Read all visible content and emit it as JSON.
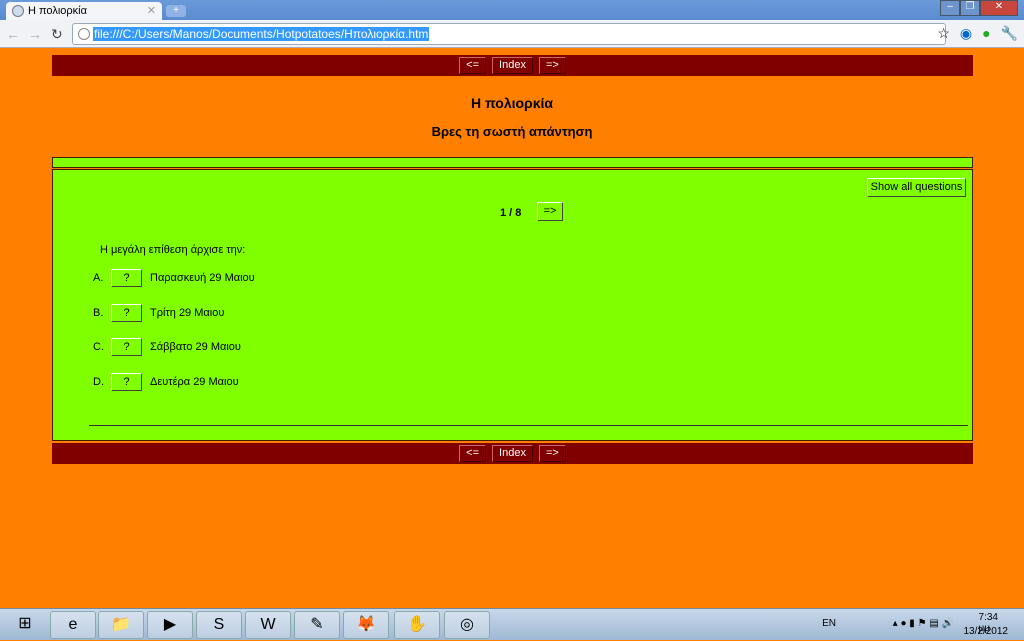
{
  "browser": {
    "tab_title": "Η πολιορκία",
    "url": "file:///C:/Users/Manos/Documents/Hotpotatoes/Ηπολιορκία.htm"
  },
  "nav": {
    "prev": "<=",
    "index": "Index",
    "next": "=>"
  },
  "page": {
    "title": "Η πολιορκία",
    "subtitle": "Βρες τη σωστή απάντηση"
  },
  "quiz": {
    "show_all": "Show all questions",
    "counter": "1 / 8",
    "next": "=>",
    "question": "Η μεγάλη επίθεση άρχισε την:",
    "options": [
      {
        "letter": "A.",
        "button": "?",
        "text": "Παρασκευή 29 Μαιου"
      },
      {
        "letter": "B.",
        "button": "?",
        "text": "Τρίτη 29 Μαιου"
      },
      {
        "letter": "C.",
        "button": "?",
        "text": "Σάββατο 29 Μαιου"
      },
      {
        "letter": "D.",
        "button": "?",
        "text": "Δευτέρα 29 Μαιου"
      }
    ]
  },
  "tray": {
    "lang": "EN",
    "time": "7:34 μμ",
    "date": "13/2/2012"
  },
  "colors": {
    "background": "#ff8000",
    "navbar": "#800000",
    "panel": "#80ff00"
  }
}
